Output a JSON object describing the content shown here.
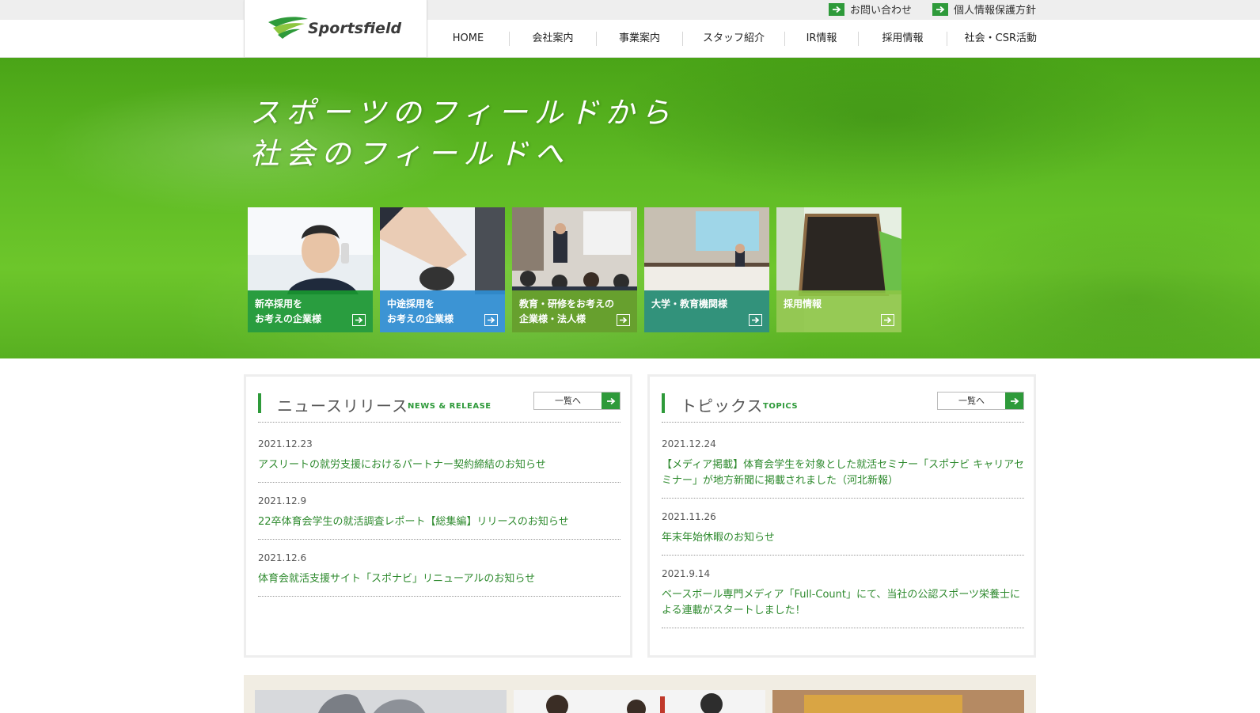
{
  "header": {
    "brand": "Sportsfield",
    "util_links": [
      {
        "label": "お問い合わせ"
      },
      {
        "label": "個人情報保護方針"
      }
    ],
    "nav": [
      {
        "label": "HOME"
      },
      {
        "label": "会社案内"
      },
      {
        "label": "事業案内"
      },
      {
        "label": "スタッフ紹介"
      },
      {
        "label": "IR情報"
      },
      {
        "label": "採用情報"
      },
      {
        "label": "社会・CSR活動"
      }
    ]
  },
  "hero": {
    "line1": "スポーツのフィールドから",
    "line2": "社会のフィールドへ",
    "tiles": [
      {
        "line1": "新卒採用を",
        "line2": "お考えの企業様",
        "color": "#1e9a35"
      },
      {
        "line1": "中途採用を",
        "line2": "お考えの企業様",
        "color": "#2f8fd1"
      },
      {
        "line1": "教育・研修をお考えの",
        "line2": "企業様・法人様",
        "color": "#6fae2b"
      },
      {
        "line1": "",
        "line2": "大学・教育機関様",
        "color": "#2d9a83"
      },
      {
        "line1": "",
        "line2": "採用情報",
        "color": "#8dc546"
      }
    ]
  },
  "news": {
    "title": "ニュースリリース",
    "subtitle": "NEWS & RELEASE",
    "list_button": "一覧へ",
    "items": [
      {
        "date": "2021.12.23",
        "title": "アスリートの就労支援におけるパートナー契約締結のお知らせ"
      },
      {
        "date": "2021.12.9",
        "title": "22卒体育会学生の就活調査レポート【総集編】リリースのお知らせ"
      },
      {
        "date": "2021.12.6",
        "title": "体育会就活支援サイト「スポナビ」リニューアルのお知らせ"
      }
    ]
  },
  "topics": {
    "title": "トピックス",
    "subtitle": "TOPICS",
    "list_button": "一覧へ",
    "items": [
      {
        "date": "2021.12.24",
        "title": "【メディア掲載】体育会学生を対象とした就活セミナー「スポナビ キャリアセミナー」が地方新聞に掲載されました（河北新報）"
      },
      {
        "date": "2021.11.26",
        "title": "年末年始休暇のお知らせ"
      },
      {
        "date": "2021.9.14",
        "title": "ベースボール専門メディア「Full-Count」にて、当社の公認スポーツ栄養士による連載がスタートしました！"
      }
    ]
  },
  "colors": {
    "accent": "#2e9a3a",
    "link": "#2e8a2e",
    "grass": "#5fbb24"
  },
  "icons": [
    "arrow-right-icon",
    "logo-swoosh-icon"
  ]
}
